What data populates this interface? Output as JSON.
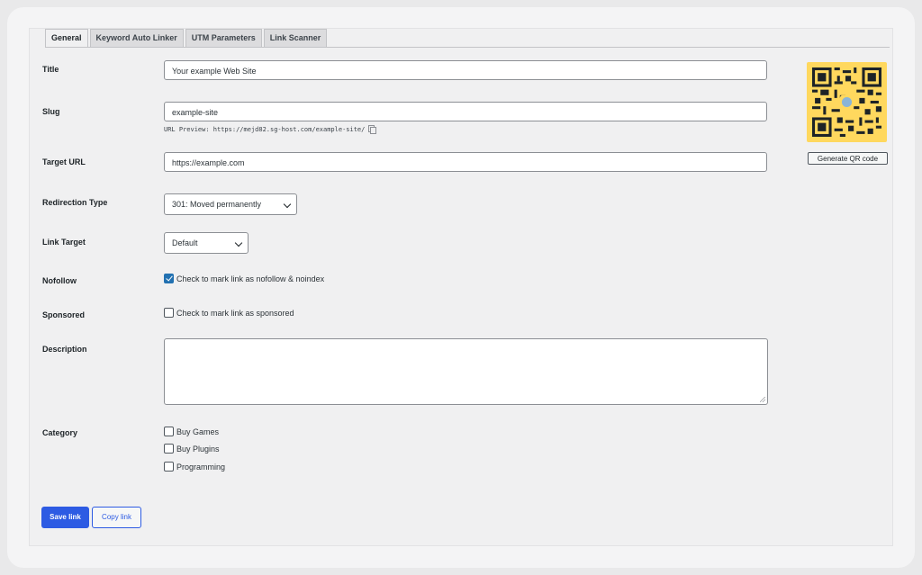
{
  "tabs": [
    "General",
    "Keyword Auto Linker",
    "UTM Parameters",
    "Link Scanner"
  ],
  "fields": {
    "title": {
      "label": "Title",
      "value": "Your example Web Site"
    },
    "slug": {
      "label": "Slug",
      "value": "example-site",
      "preview": "URL Preview: https://mejd82.sg-host.com/example-site/"
    },
    "target": {
      "label": "Target URL",
      "value": "https://example.com"
    },
    "redirection": {
      "label": "Redirection Type",
      "value": "301: Moved permanently"
    },
    "link_target": {
      "label": "Link Target",
      "value": "Default"
    },
    "nofollow": {
      "label": "Nofollow",
      "text": "Check to mark link as nofollow & noindex",
      "checked": true
    },
    "sponsored": {
      "label": "Sponsored",
      "text": "Check to mark link as sponsored",
      "checked": false
    },
    "description": {
      "label": "Description",
      "value": ""
    },
    "category": {
      "label": "Category",
      "options": [
        "Buy Games",
        "Buy Plugins",
        "Programming"
      ]
    }
  },
  "qr": {
    "button": "Generate QR code",
    "color": "#ffd85e"
  },
  "actions": {
    "save": "Save link",
    "copy": "Copy link"
  },
  "colors": {
    "accent": "#2d5be3",
    "checkbox": "#2271b1"
  }
}
